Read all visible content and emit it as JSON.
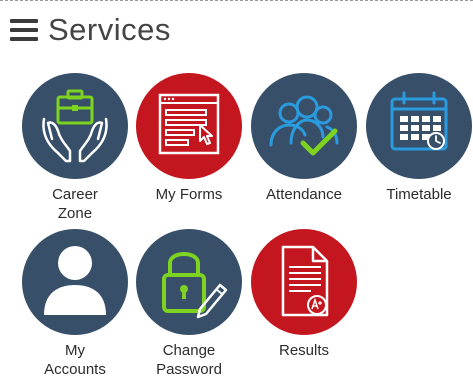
{
  "header": {
    "title": "Services"
  },
  "colors": {
    "navy": "#374f68",
    "red": "#c4161f",
    "green": "#7ed321",
    "blue": "#2b9be0"
  },
  "tiles": [
    {
      "label_line1": "Career",
      "label_line2": "Zone",
      "icon": "career-zone-icon",
      "color": "navy"
    },
    {
      "label_line1": "My Forms",
      "label_line2": "",
      "icon": "forms-icon",
      "color": "red"
    },
    {
      "label_line1": "Attendance",
      "label_line2": "",
      "icon": "attendance-icon",
      "color": "navy"
    },
    {
      "label_line1": "Timetable",
      "label_line2": "",
      "icon": "calendar-icon",
      "color": "navy"
    },
    {
      "label_line1": "My",
      "label_line2": "Accounts",
      "icon": "user-icon",
      "color": "navy"
    },
    {
      "label_line1": "Change",
      "label_line2": "Password",
      "icon": "lock-icon",
      "color": "navy"
    },
    {
      "label_line1": "Results",
      "label_line2": "",
      "icon": "results-document-icon",
      "color": "red"
    }
  ]
}
